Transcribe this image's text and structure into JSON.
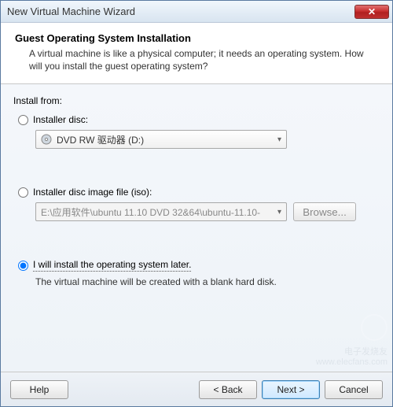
{
  "window": {
    "title": "New Virtual Machine Wizard",
    "close_glyph": "✕"
  },
  "header": {
    "title": "Guest Operating System Installation",
    "description": "A virtual machine is like a physical computer; it needs an operating system. How will you install the guest operating system?"
  },
  "content": {
    "install_from_label": "Install from:",
    "option_disc": {
      "label": "Installer disc:",
      "dropdown_value": "DVD RW 驱动器 (D:)"
    },
    "option_iso": {
      "label": "Installer disc image file (iso):",
      "dropdown_value": "E:\\应用软件\\ubuntu 11.10 DVD 32&64\\ubuntu-11.10-",
      "browse_label": "Browse..."
    },
    "option_later": {
      "label": "I will install the operating system later.",
      "description": "The virtual machine will be created with a blank hard disk."
    }
  },
  "watermark": {
    "text": "电子发烧友",
    "sub": "www.elecfans.com"
  },
  "footer": {
    "help": "Help",
    "back": "< Back",
    "next": "Next >",
    "cancel": "Cancel"
  }
}
